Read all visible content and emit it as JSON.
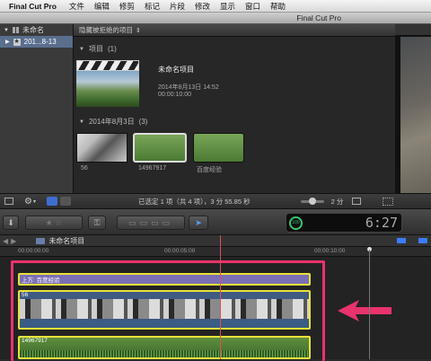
{
  "menubar": {
    "app": "Final Cut Pro",
    "items": [
      "文件",
      "编辑",
      "修剪",
      "标记",
      "片段",
      "修改",
      "显示",
      "窗口",
      "帮助"
    ]
  },
  "window": {
    "title": "Final Cut Pro"
  },
  "library": {
    "name": "未命名",
    "event": "201...8-13"
  },
  "browser": {
    "filter": "隐藏被拒绝的项目",
    "projects_section": {
      "label": "项目",
      "count": "(1)"
    },
    "project": {
      "name": "未命名项目",
      "date": "2014年8月13日 14:52",
      "duration": "00:00:10:00"
    },
    "event_section": {
      "label": "2014年8月3日",
      "count": "(3)"
    },
    "clips": [
      {
        "name": "56"
      },
      {
        "name": "14967917"
      },
      {
        "name": "百度经验"
      }
    ]
  },
  "status": {
    "text": "已选定 1 项（共 4 项），3 分 55.85 秒",
    "zoom": "2 分"
  },
  "toolbar": {
    "timecode": "6:27",
    "percent": "100"
  },
  "timeline": {
    "project_name": "未命名项目",
    "ruler": [
      "00:00:00:00",
      "00:00:05:00",
      "00:00:10:00"
    ],
    "clips": [
      {
        "label": "上方: 百度经验"
      },
      {
        "label": "56"
      },
      {
        "label": "14967917"
      }
    ]
  },
  "colors": {
    "highlight_box": "#e8336d",
    "arrow": "#e8336d",
    "selection": "#e8e23a",
    "playhead": "#e05050"
  }
}
